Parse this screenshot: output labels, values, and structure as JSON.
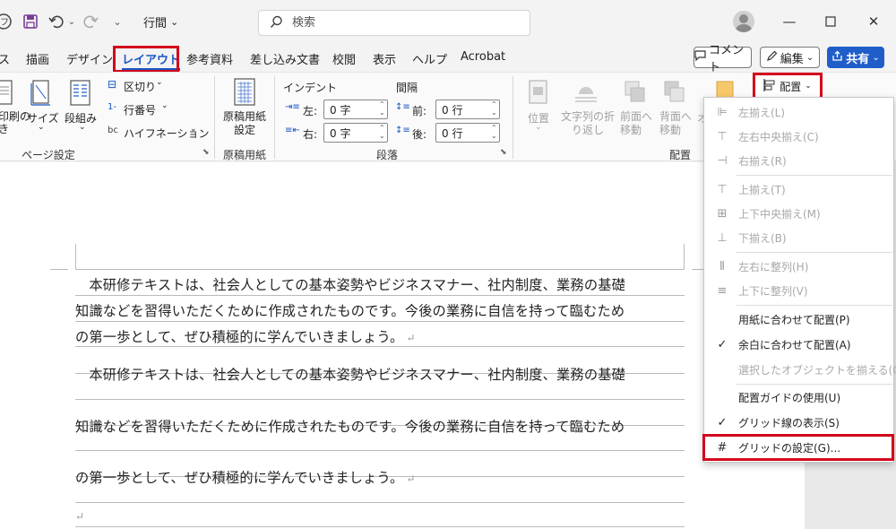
{
  "titlebar": {
    "file_title": "行間",
    "search_placeholder": "検索"
  },
  "tabs": [
    {
      "label": "ス"
    },
    {
      "label": "描画"
    },
    {
      "label": "デザイン"
    },
    {
      "label": "レイアウト"
    },
    {
      "label": "参考資料"
    },
    {
      "label": "差し込み文書"
    },
    {
      "label": "校閲"
    },
    {
      "label": "表示"
    },
    {
      "label": "ヘルプ"
    },
    {
      "label": "Acrobat"
    }
  ],
  "tab_actions": {
    "comment": "コメント",
    "edit": "編集",
    "share": "共有"
  },
  "ribbon": {
    "page_setup": {
      "direction_label": "印刷の\nき",
      "size_label": "サイズ",
      "columns_label": "段組み",
      "breaks_label": "区切り",
      "line_numbers_label": "行番号",
      "hyphenation_label": "ハイフネーション",
      "group_label": "ページ設定"
    },
    "manuscript": {
      "button_label": "原稿用紙\n設定",
      "group_label": "原稿用紙"
    },
    "paragraph": {
      "indent_header": "インデント",
      "spacing_header": "間隔",
      "left_label": "左:",
      "left_value": "0 字",
      "right_label": "右:",
      "right_value": "0 字",
      "before_label": "前:",
      "before_value": "0 行",
      "after_label": "後:",
      "after_value": "0 行",
      "group_label": "段落"
    },
    "arrange": {
      "position_label": "位置",
      "wrap_label": "文字列の折\nり返し",
      "forward_label": "前面へ\n移動",
      "backward_label": "背面へ\n移動",
      "group_label": "配置",
      "arrange_button": "配置",
      "partial_label": "オ"
    }
  },
  "document": {
    "lines": [
      "　本研修テキストは、社会人としての基本姿勢やビジネスマナー、社内制度、業務の基礎",
      "知識などを習得いただくために作成されたものです。今後の業務に自信を持って臨むため",
      "の第一歩として、ぜひ積極的に学んでいきましょう。",
      "　本研修テキストは、社会人としての基本姿勢やビジネスマナー、社内制度、業務の基礎",
      "知識などを習得いただくために作成されたものです。今後の業務に自信を持って臨むため",
      "の第一歩として、ぜひ積極的に学んでいきましょう。"
    ],
    "para_mark": "↵"
  },
  "arrange_menu": {
    "items": [
      {
        "label": "左揃え(L)",
        "icon": "align-left-icon"
      },
      {
        "label": "左右中央揃え(C)",
        "icon": "align-center-icon"
      },
      {
        "label": "右揃え(R)",
        "icon": "align-right-icon"
      },
      {
        "label": "上揃え(T)",
        "icon": "align-top-icon"
      },
      {
        "label": "上下中央揃え(M)",
        "icon": "align-middle-icon"
      },
      {
        "label": "下揃え(B)",
        "icon": "align-bottom-icon"
      },
      {
        "label": "左右に整列(H)",
        "icon": "distribute-horizontal-icon"
      },
      {
        "label": "上下に整列(V)",
        "icon": "distribute-vertical-icon"
      },
      {
        "label": "用紙に合わせて配置(P)",
        "checked": false
      },
      {
        "label": "余白に合わせて配置(A)",
        "checked": true
      },
      {
        "label": "選択したオブジェクトを揃える(O)"
      },
      {
        "label": "配置ガイドの使用(U)"
      },
      {
        "label": "グリッド線の表示(S)",
        "checked": true
      },
      {
        "label": "グリッドの設定(G)...",
        "icon": "grid-icon"
      }
    ]
  },
  "colors": {
    "accent_blue": "#1b56c4",
    "highlight_red": "#d3071b",
    "share_blue": "#1f5ec9"
  }
}
